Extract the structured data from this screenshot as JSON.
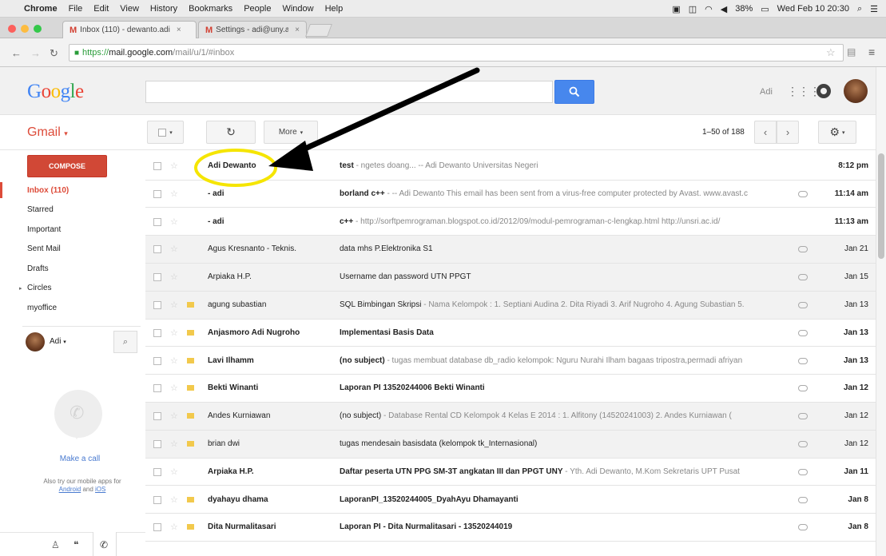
{
  "menubar": {
    "app": "Chrome",
    "items": [
      "File",
      "Edit",
      "View",
      "History",
      "Bookmarks",
      "People",
      "Window",
      "Help"
    ],
    "battery": "38%",
    "clock": "Wed Feb 10  20:30"
  },
  "tabs": [
    {
      "label": "Inbox (110) - dewanto.adi"
    },
    {
      "label": "Settings - adi@uny.ac.id"
    }
  ],
  "address": {
    "scheme": "https://",
    "host": "mail.google.com",
    "path": "/mail/u/1/#inbox"
  },
  "header": {
    "logo": "Google",
    "search_placeholder": "",
    "user_name": "Adi"
  },
  "toolbar": {
    "app_name": "Gmail",
    "more_label": "More",
    "page_info": "1–50 of 188"
  },
  "sidebar": {
    "compose_label": "COMPOSE",
    "items": [
      {
        "label": "Inbox (110)"
      },
      {
        "label": "Starred"
      },
      {
        "label": "Important"
      },
      {
        "label": "Sent Mail"
      },
      {
        "label": "Drafts"
      },
      {
        "label": "Circles"
      },
      {
        "label": "myoffice"
      }
    ],
    "hangouts_user": "Adi",
    "make_call": "Make a call",
    "also_try": "Also try our mobile apps for",
    "android": "Android",
    "and_word": "and",
    "ios": "iOS"
  },
  "messages": [
    {
      "sender": "Adi Dewanto",
      "subject": "test",
      "snippet": " - ngetes doang... -- Adi Dewanto Universitas Negeri",
      "date": "8:12 pm",
      "unread": true,
      "important": false,
      "attachment": false
    },
    {
      "sender": "- adi",
      "subject": "borland c++",
      "snippet": " - -- Adi Dewanto This email has been sent from a virus-free computer protected by Avast. www.avast.c",
      "date": "11:14 am",
      "unread": true,
      "important": false,
      "attachment": true
    },
    {
      "sender": "- adi",
      "subject": "c++",
      "snippet": " - http://sorftpemrograman.blogspot.co.id/2012/09/modul-pemrograman-c-lengkap.html http://unsri.ac.id/",
      "date": "11:13 am",
      "unread": true,
      "important": false,
      "attachment": false
    },
    {
      "sender": "Agus Kresnanto - Teknis.",
      "subject": "data mhs P.Elektronika S1",
      "snippet": "",
      "date": "Jan 21",
      "unread": false,
      "important": false,
      "attachment": true
    },
    {
      "sender": "Arpiaka H.P.",
      "subject": "Username dan password UTN PPGT",
      "snippet": "",
      "date": "Jan 15",
      "unread": false,
      "important": false,
      "attachment": true
    },
    {
      "sender": "agung subastian",
      "subject": "SQL Bimbingan Skripsi",
      "snippet": " - Nama Kelompok : 1. Septiani Audina 2. Dita Riyadi 3. Arif Nugroho 4. Agung Subastian 5.",
      "date": "Jan 13",
      "unread": false,
      "important": true,
      "attachment": true
    },
    {
      "sender": "Anjasmoro Adi Nugroho",
      "subject": "Implementasi Basis Data",
      "snippet": "",
      "date": "Jan 13",
      "unread": true,
      "important": true,
      "attachment": true
    },
    {
      "sender": "Lavi Ilhamm",
      "subject": "(no subject)",
      "snippet": " - tugas membuat database db_radio kelompok: Nguru Nurahi Ilham bagaas tripostra,permadi afriyan",
      "date": "Jan 13",
      "unread": true,
      "important": true,
      "attachment": true
    },
    {
      "sender": "Bekti Winanti",
      "subject": "Laporan PI 13520244006 Bekti Winanti",
      "snippet": "",
      "date": "Jan 12",
      "unread": true,
      "important": true,
      "attachment": true
    },
    {
      "sender": "Andes Kurniawan",
      "subject": "(no subject)",
      "snippet": " - Database Rental CD Kelompok 4 Kelas E 2014 : 1. Alfitony (14520241003) 2. Andes Kurniawan (",
      "date": "Jan 12",
      "unread": false,
      "important": true,
      "attachment": true
    },
    {
      "sender": "brian dwi",
      "subject": "tugas mendesain basisdata (kelompok tk_Internasional)",
      "snippet": "",
      "date": "Jan 12",
      "unread": false,
      "important": true,
      "attachment": true
    },
    {
      "sender": "Arpiaka H.P.",
      "subject": "Daftar peserta UTN PPG SM-3T angkatan III dan PPGT UNY",
      "snippet": " - Yth. Adi Dewanto, M.Kom Sekretaris UPT Pusat",
      "date": "Jan 11",
      "unread": true,
      "important": false,
      "attachment": true
    },
    {
      "sender": "dyahayu dhama",
      "subject": "LaporanPI_13520244005_DyahAyu Dhamayanti",
      "snippet": "",
      "date": "Jan 8",
      "unread": true,
      "important": true,
      "attachment": true
    },
    {
      "sender": "Dita Nurmalitasari",
      "subject": "Laporan PI - Dita Nurmalitasari - 13520244019",
      "snippet": "",
      "date": "Jan 8",
      "unread": true,
      "important": true,
      "attachment": true
    }
  ],
  "colors": {
    "accent_red": "#dd4b39",
    "search_blue": "#4787ed",
    "annotation_yellow": "#f5e500"
  }
}
